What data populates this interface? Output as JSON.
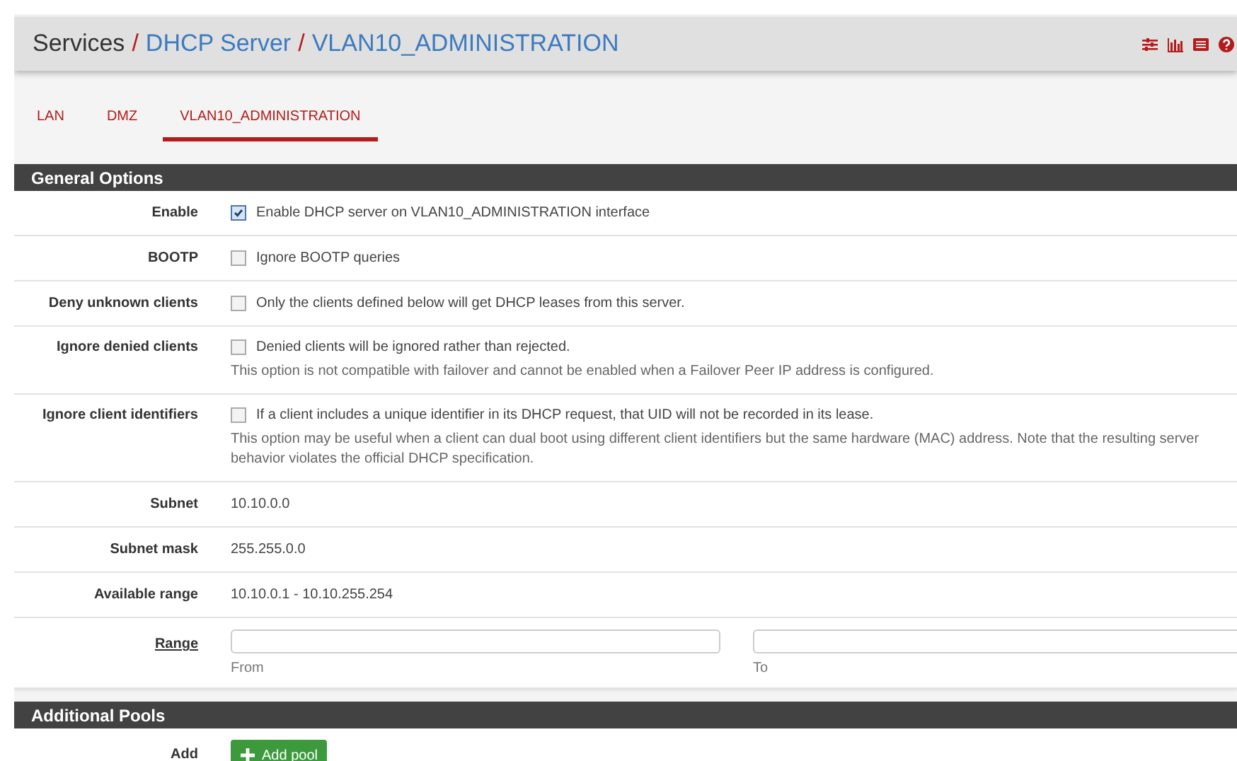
{
  "breadcrumb_separator": "/",
  "breadcrumb": [
    {
      "label": "Services",
      "link": false
    },
    {
      "label": "DHCP Server",
      "link": true
    },
    {
      "label": "VLAN10_ADMINISTRATION",
      "link": true
    }
  ],
  "tabs": [
    {
      "label": "LAN",
      "selected": false
    },
    {
      "label": "DMZ",
      "selected": false
    },
    {
      "label": "VLAN10_ADMINISTRATION",
      "selected": true
    }
  ],
  "sections": [
    {
      "title": "General Options",
      "rows": [
        {
          "kind": "checkbox",
          "label": "Enable",
          "checked": true,
          "text": "Enable DHCP server on VLAN10_ADMINISTRATION interface"
        },
        {
          "kind": "checkbox",
          "label": "BOOTP",
          "checked": false,
          "text": "Ignore BOOTP queries"
        },
        {
          "kind": "checkbox",
          "label": "Deny unknown clients",
          "checked": false,
          "text": "Only the clients defined below will get DHCP leases from this server."
        },
        {
          "kind": "checkbox",
          "label": "Ignore denied clients",
          "checked": false,
          "text": "Denied clients will be ignored rather than rejected.",
          "help": "This option is not compatible with failover and cannot be enabled when a Failover Peer IP address is configured."
        },
        {
          "kind": "checkbox",
          "label": "Ignore client identifiers",
          "checked": false,
          "text": "If a client includes a unique identifier in its DHCP request, that UID will not be recorded in its lease.",
          "help": "This option may be useful when a client can dual boot using different client identifiers but the same hardware (MAC) address. Note that the resulting server behavior violates the official DHCP specification."
        },
        {
          "kind": "text",
          "label": "Subnet",
          "text": "10.10.0.0"
        },
        {
          "kind": "text",
          "label": "Subnet mask",
          "text": "255.255.0.0"
        },
        {
          "kind": "text",
          "label": "Available range",
          "text": "10.10.0.1 - 10.10.255.254"
        },
        {
          "kind": "range",
          "label": "Range",
          "from_label": "From",
          "to_label": "To"
        }
      ]
    },
    {
      "title": "Additional Pools",
      "rows": [
        {
          "kind": "button",
          "label": "Add",
          "button": "Add pool"
        }
      ]
    }
  ]
}
